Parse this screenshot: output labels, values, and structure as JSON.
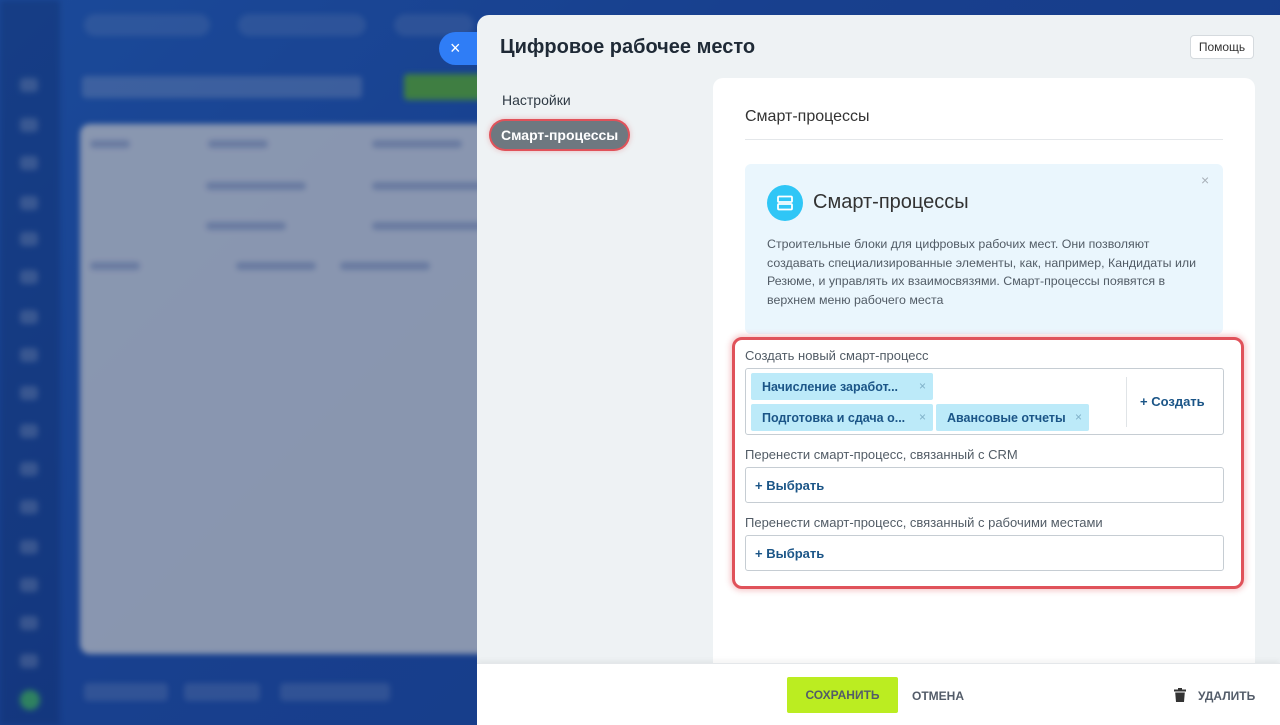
{
  "slider": {
    "title": "Цифровое рабочее место",
    "help_label": "Помощь",
    "close_icon": "×"
  },
  "nav": {
    "items": [
      {
        "label": "Настройки",
        "active": false
      },
      {
        "label": "Смарт-процессы",
        "active": true
      }
    ]
  },
  "content": {
    "section_title": "Смарт-процессы",
    "info": {
      "title": "Смарт-процессы",
      "icon": "layers-icon",
      "text": "Строительные блоки для цифровых рабочих мест. Они позволяют создавать специализированные элементы, как, например, Кандидаты или Резюме, и управлять их взаимосвязями. Смарт-процессы появятся в верхнем меню рабочего места"
    },
    "create_field": {
      "label": "Создать новый смарт-процесс",
      "tags": [
        "Начисление заработ...",
        "Подготовка и сдача о...",
        "Авансовые отчеты"
      ],
      "create_label": "+ Создать"
    },
    "crm_field": {
      "label": "Перенести смарт-процесс, связанный с CRM",
      "select_label": "+ Выбрать"
    },
    "workplace_field": {
      "label": "Перенести смарт-процесс, связанный с рабочими местами",
      "select_label": "+ Выбрать"
    }
  },
  "footer": {
    "save_label": "СОХРАНИТЬ",
    "cancel_label": "ОТМЕНА",
    "delete_label": "УДАЛИТЬ"
  },
  "colors": {
    "accent_blue": "#2f7df6",
    "save_green": "#bbed21",
    "highlight_red": "#e0525a",
    "tag_bg": "#bceaf9",
    "info_icon": "#2fc6f6"
  }
}
